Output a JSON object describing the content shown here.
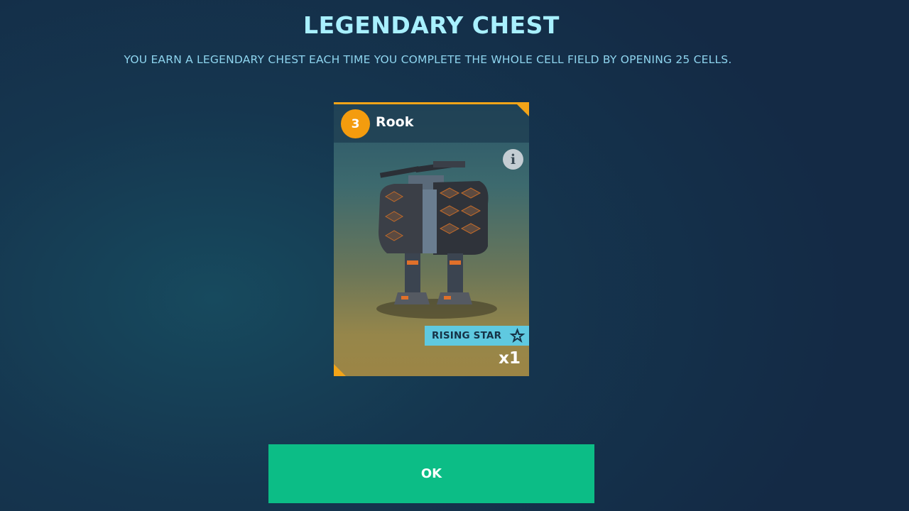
{
  "header": {
    "title": "LEGENDARY CHEST",
    "subtitle": "YOU EARN A LEGENDARY CHEST EACH TIME YOU COMPLETE THE WHOLE CELL FIELD BY OPENING 25 CELLS."
  },
  "card": {
    "level": "3",
    "name": "Rook",
    "tag": "RISING STAR",
    "quantity": "x1",
    "info_icon": "info-icon",
    "accent_color": "#f2a418"
  },
  "actions": {
    "ok_label": "OK",
    "ok_color": "#0cbd86"
  }
}
